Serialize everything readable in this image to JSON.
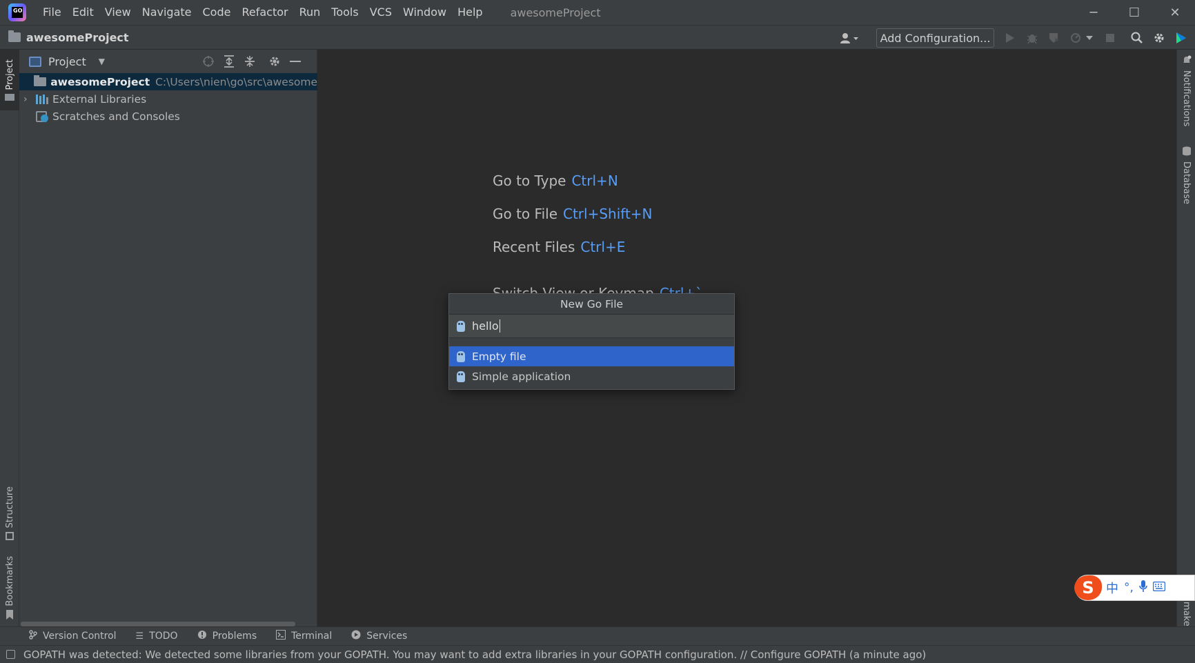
{
  "app": {
    "logo_text": "GO",
    "window_title": "awesomeProject"
  },
  "menu": [
    "File",
    "Edit",
    "View",
    "Navigate",
    "Code",
    "Refactor",
    "Run",
    "Tools",
    "VCS",
    "Window",
    "Help"
  ],
  "window_controls": {
    "minimize": "─",
    "maximize": "☐",
    "close": "✕"
  },
  "navbar": {
    "project_name": "awesomeProject",
    "add_configuration": "Add Configuration..."
  },
  "left_tabs": {
    "project": "Project",
    "structure": "Structure",
    "bookmarks": "Bookmarks"
  },
  "right_tabs": {
    "notifications": "Notifications",
    "database": "Database",
    "make": "make"
  },
  "project_panel": {
    "title": "Project",
    "tree": {
      "root_name": "awesomeProject",
      "root_path": "C:\\Users\\nien\\go\\src\\awesomeProject",
      "external_libraries": "External Libraries",
      "scratches": "Scratches and Consoles"
    }
  },
  "editor_hints": [
    {
      "label": "Go to Type",
      "key": "Ctrl+N"
    },
    {
      "label": "Go to File",
      "key": "Ctrl+Shift+N"
    },
    {
      "label": "Recent Files",
      "key": "Ctrl+E"
    },
    {
      "label": "Switch View or Keymap",
      "key": "Ctrl+`"
    }
  ],
  "popup": {
    "title": "New Go File",
    "input_value": "hello",
    "items": [
      "Empty file",
      "Simple application"
    ]
  },
  "bottom_tabs": [
    "Version Control",
    "TODO",
    "Problems",
    "Terminal",
    "Services"
  ],
  "status_bar": {
    "message": "GOPATH was detected: We detected some libraries from your GOPATH. You may want to add extra libraries in your GOPATH configuration. // Configure GOPATH (a minute ago)"
  },
  "ime": {
    "logo": "S",
    "lang": "中"
  }
}
